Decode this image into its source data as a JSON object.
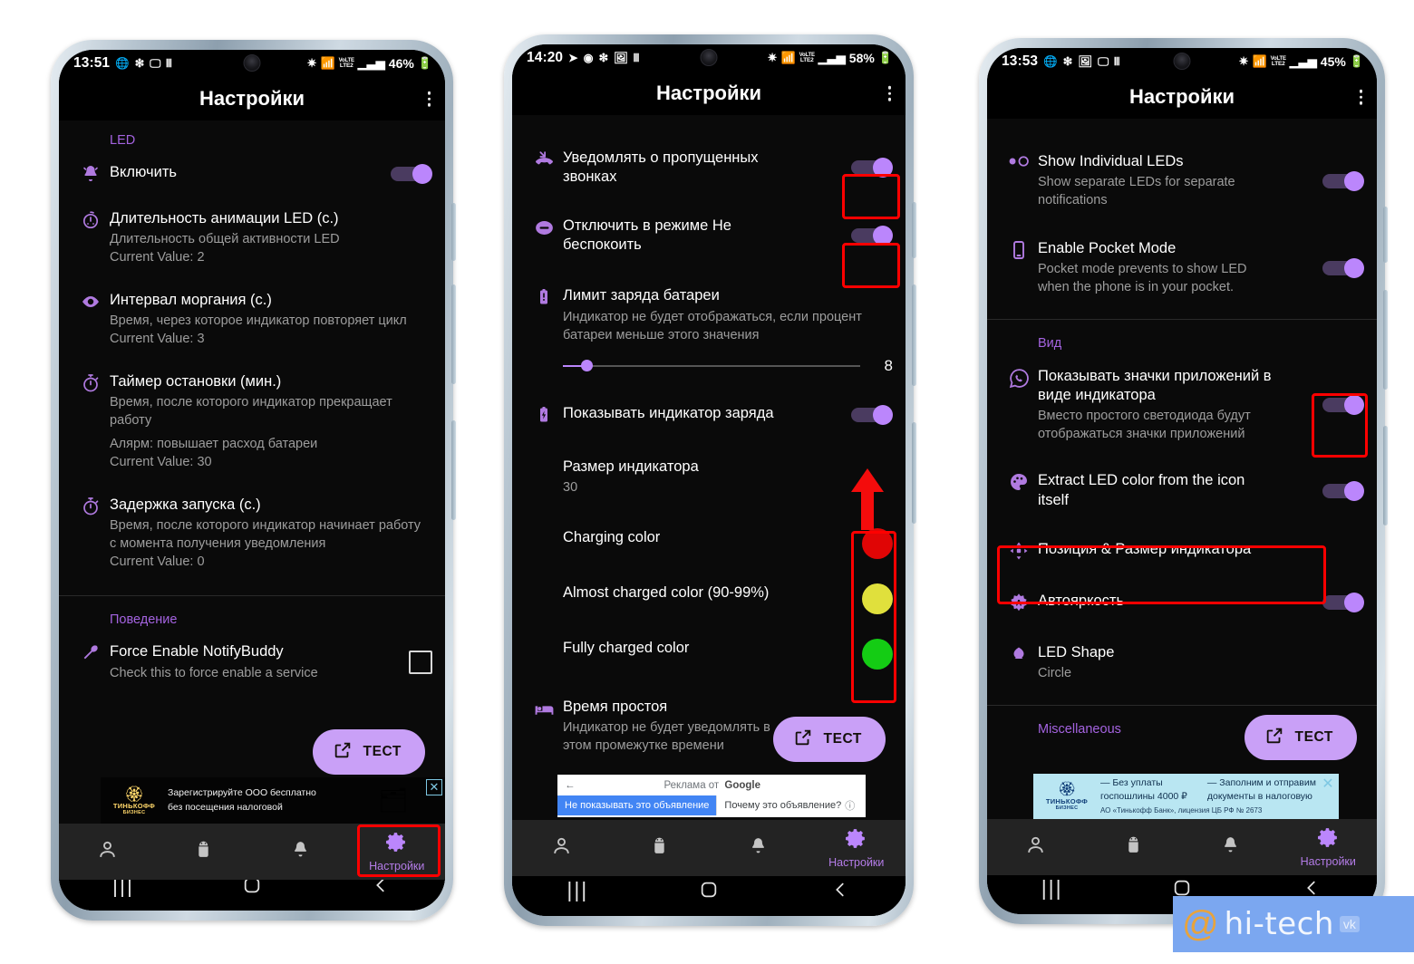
{
  "app": {
    "title": "Настройки",
    "accent": "#bb86fc",
    "section_color": "#a463e0",
    "highlight_color": "#fe0000"
  },
  "nav": {
    "items": [
      {
        "icon": "person-icon",
        "label": "",
        "active": false
      },
      {
        "icon": "android-robot-icon",
        "label": "",
        "active": false
      },
      {
        "icon": "bell-icon",
        "label": "",
        "active": false
      },
      {
        "icon": "gear-icon",
        "label": "Настройки",
        "active": true
      }
    ]
  },
  "gestures": {
    "recents": "recents-icon",
    "home": "home-icon",
    "back": "back-icon"
  },
  "fab": {
    "label": "ТЕСТ",
    "icon": "external-link-icon"
  },
  "phone1": {
    "status": {
      "time": "13:51",
      "left_icons": [
        "rss-icon",
        "bluetooth-snowflake-icon",
        "cast-icon",
        "music-icon"
      ],
      "right_icons": [
        "bluetooth-icon",
        "wifi-icon",
        "volte-lte2-icon",
        "signal-icon"
      ],
      "battery": "46%"
    },
    "title": "Настройки",
    "sections": [
      {
        "label": "LED",
        "rows": [
          {
            "icon": "bell-icon",
            "title": "Включить",
            "subtitle": "",
            "value": "",
            "control": "toggle",
            "toggle_on": true
          },
          {
            "icon": "stopwatch-dots-icon",
            "title": "Длительность анимации LED (с.)",
            "subtitle": "Длительность общей активности LED",
            "value": "Current Value: 2",
            "control": "none"
          },
          {
            "icon": "eye-icon",
            "title": "Интервал моргания (с.)",
            "subtitle": "Время, через которое индикатор повторяет цикл",
            "value": "Current Value: 3",
            "control": "none"
          },
          {
            "icon": "timer-icon",
            "title": "Таймер остановки (мин.)",
            "subtitle": "Время, после которого индикатор прекращает работу",
            "note": "Алярм: повышает расход батареи",
            "value": "Current Value: 30",
            "control": "none"
          },
          {
            "icon": "timer-icon",
            "title": "Задержка запуска (с.)",
            "subtitle": "Время, после которого индикатор начинает работу с момента получения уведомления",
            "value": "Current Value: 0",
            "control": "none"
          }
        ]
      },
      {
        "label": "Поведение",
        "rows": [
          {
            "icon": "wrench-icon",
            "title": "Force Enable NotifyBuddy",
            "subtitle": "Check this to force enable a service",
            "value": "",
            "control": "checkbox"
          }
        ]
      }
    ],
    "ad": {
      "type": "tinkoff-dark",
      "brand": "ТИНЬКОФФ",
      "brand2": "БИЗНЕС",
      "line1": "Зарегистрируйте ООО бесплатно",
      "line2": "без посещения налоговой",
      "close": "✕"
    },
    "highlight_target": "nav-settings"
  },
  "phone2": {
    "status": {
      "time": "14:20",
      "left_icons": [
        "telegram-icon",
        "instagram-icon",
        "bluetooth-snowflake-icon",
        "photo-icon",
        "music-icon"
      ],
      "right_icons": [
        "bluetooth-icon",
        "wifi-icon",
        "volte-lte2-icon",
        "signal-icon"
      ],
      "battery": "58%"
    },
    "title": "Настройки",
    "rows": [
      {
        "icon": "missed-call-icon",
        "title": "Уведомлять о пропущенных звонках",
        "control": "toggle",
        "toggle_on": true,
        "highlighted": true
      },
      {
        "icon": "do-not-disturb-icon",
        "title": "Отключить в режиме Не беспокоить",
        "control": "toggle",
        "toggle_on": true,
        "highlighted": true
      },
      {
        "icon": "battery-alert-icon",
        "title": "Лимит заряда батареи",
        "subtitle": "Индикатор не будет отображаться, если процент батареи меньше этого значения",
        "control": "slider",
        "slider": {
          "value": "8",
          "percent": 8,
          "min": 0,
          "max": 100
        }
      },
      {
        "icon": "battery-charging-icon",
        "title": "Показывать индикатор заряда",
        "control": "toggle",
        "toggle_on": true,
        "arrow": true
      },
      {
        "icon": "",
        "title": "Размер индикатора",
        "subtitle": "30",
        "control": "none"
      },
      {
        "icon": "",
        "title": "Charging color",
        "control": "color",
        "color": "#e00505",
        "color_group": true
      },
      {
        "icon": "",
        "title": "Almost charged color (90-99%)",
        "control": "color",
        "color": "#e0e03c",
        "color_group": true
      },
      {
        "icon": "",
        "title": "Fully charged color",
        "control": "color",
        "color": "#14cc14",
        "color_group": true
      },
      {
        "icon": "bed-icon",
        "title": "Время простоя",
        "subtitle": "Индикатор не будет уведомлять в этом промежутке времени",
        "control": "none"
      }
    ],
    "ad": {
      "type": "google",
      "header": "Реклама от",
      "brand": "Google",
      "back": "←",
      "btn1": "Не показывать это объявление",
      "btn2": "Почему это объявление?"
    }
  },
  "phone3": {
    "status": {
      "time": "13:53",
      "left_icons": [
        "rss-icon",
        "bluetooth-snowflake-icon",
        "photo-icon",
        "cast-icon",
        "music-icon"
      ],
      "right_icons": [
        "bluetooth-icon",
        "wifi-icon",
        "volte-lte2-icon",
        "signal-icon"
      ],
      "battery": "45%"
    },
    "title": "Настройки",
    "top_rows": [
      {
        "icon": "two-dots-icon",
        "title": "Show Individual LEDs",
        "subtitle": "Show separate LEDs for separate notifications",
        "control": "toggle",
        "toggle_on": true
      },
      {
        "icon": "phone-icon",
        "title": "Enable Pocket Mode",
        "subtitle": "Pocket mode prevents to show LED when the phone is in your pocket.",
        "control": "toggle",
        "toggle_on": true
      }
    ],
    "sections": [
      {
        "label": "Вид",
        "rows": [
          {
            "icon": "whatsapp-icon",
            "title": "Показывать значки приложений в виде индикатора",
            "subtitle": "Вместо простого светодиода будут отображаться значки приложений",
            "control": "toggle",
            "toggle_on": true,
            "highlighted": true
          },
          {
            "icon": "palette-icon",
            "title": "Extract LED color from the icon itself",
            "control": "toggle",
            "toggle_on": true
          },
          {
            "icon": "move-icon",
            "title": "Позиция & Размер индикатора",
            "control": "none",
            "highlighted": true
          },
          {
            "icon": "auto-brightness-icon",
            "title": "Автояркость",
            "control": "toggle",
            "toggle_on": true
          },
          {
            "icon": "shape-icon",
            "title": "LED Shape",
            "subtitle": "Circle",
            "control": "none"
          }
        ]
      },
      {
        "label": "Miscellaneous",
        "rows": []
      }
    ],
    "ad": {
      "type": "tinkoff-light",
      "brand": "ТИНЬКОФФ",
      "brand2": "БИЗНЕС",
      "line1": "— Без уплаты",
      "line2": "госпошлины 4000 ₽",
      "line3": "— Заполним и отправим",
      "line4": "документы в налоговую",
      "legal": "АО «Тинькофф Банк», лицензия ЦБ РФ № 2673",
      "close": "✕"
    }
  },
  "watermark": {
    "text": "hi-tech",
    "badge": "vk",
    "at": "@"
  }
}
